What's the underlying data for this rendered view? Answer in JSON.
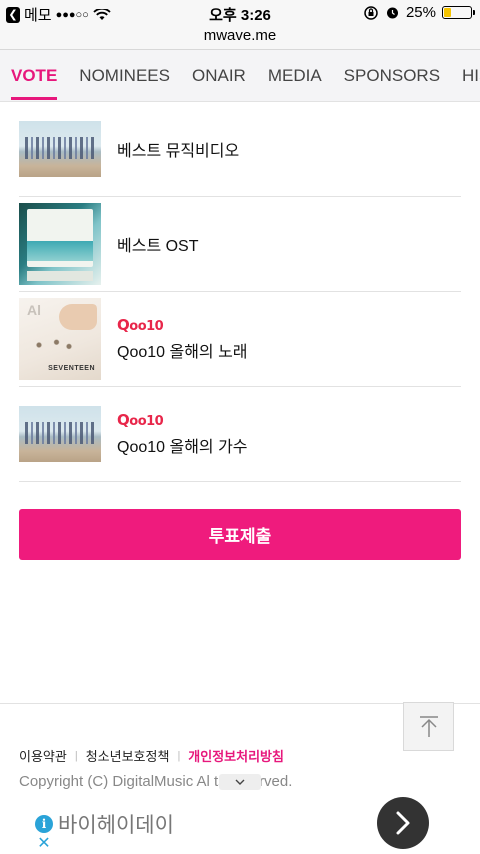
{
  "status_bar": {
    "back_app": "메모",
    "signal": "●●●○○",
    "time": "오후 3:26",
    "battery_percent_label": "25%",
    "battery_level": 0.25,
    "icons": [
      "back-chevron-icon",
      "wifi-icon",
      "rotation-lock-icon",
      "alarm-icon",
      "battery-icon"
    ]
  },
  "browser": {
    "url": "mwave.me"
  },
  "nav": {
    "tabs": [
      {
        "label": "VOTE",
        "active": true
      },
      {
        "label": "NOMINEES",
        "active": false
      },
      {
        "label": "ONAIR",
        "active": false
      },
      {
        "label": "MEDIA",
        "active": false
      },
      {
        "label": "SPONSORS",
        "active": false
      },
      {
        "label": "HISTO",
        "active": false
      }
    ],
    "accent_color": "#e7177c"
  },
  "vote_items": [
    {
      "label": "베스트 뮤직비디오",
      "sponsor": "",
      "thumb": "group-beach-photo"
    },
    {
      "label": "베스트 OST",
      "sponsor": "",
      "thumb": "ost-album-cover"
    },
    {
      "label": "Qoo10 올해의 노래",
      "sponsor": "Qoo10",
      "thumb": "seventeen-album-cover"
    },
    {
      "label": "Qoo10 올해의 가수",
      "sponsor": "Qoo10",
      "thumb": "group-beach-photo"
    }
  ],
  "thumb_text": {
    "svt_al": "Al",
    "svt_brand": "SEVENTEEN"
  },
  "submit": {
    "label": "투표제출",
    "color": "#ef1b7d"
  },
  "footer": {
    "links": [
      {
        "label": "이용약관"
      },
      {
        "label": "청소년보호정책"
      },
      {
        "label": "개인정보처리방침"
      }
    ],
    "copyright": "Copyright (C) DigitalMusic Al        ts reserved.",
    "to_top_icon": "arrow-up-icon"
  },
  "ad": {
    "title": "바이헤이데이",
    "info_icon": "info-icon",
    "close_icon": "close-icon",
    "go_icon": "chevron-right-icon"
  }
}
